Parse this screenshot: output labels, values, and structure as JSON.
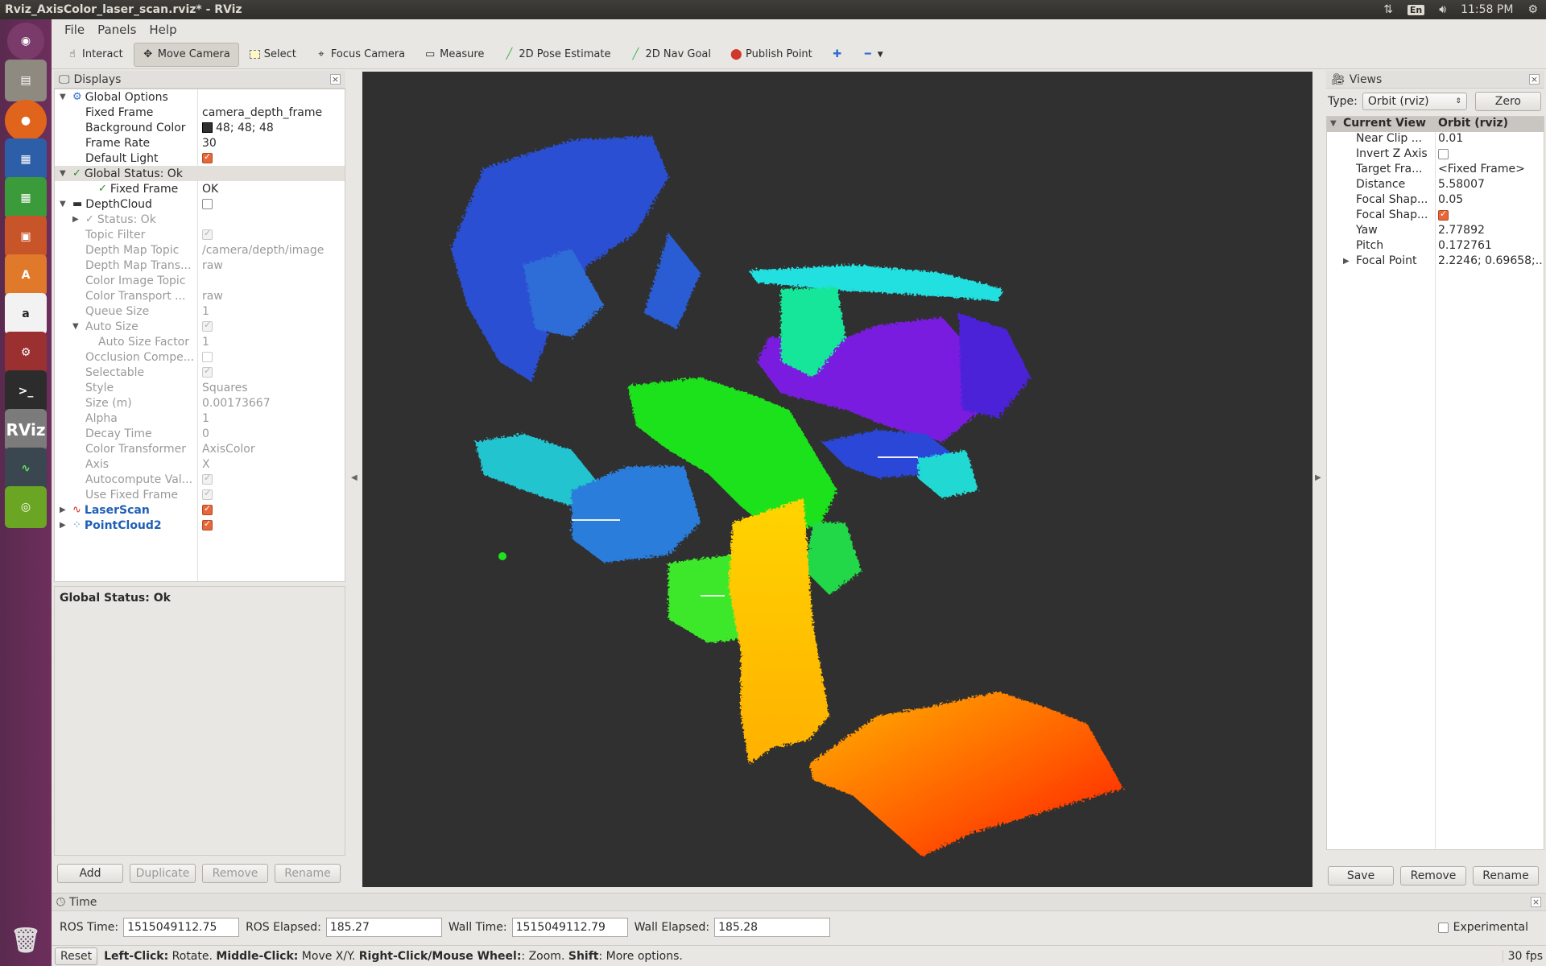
{
  "window_title": "Rviz_AxisColor_laser_scan.rviz* - RViz",
  "tray": {
    "lang": "En",
    "time": "11:58 PM"
  },
  "menu": [
    "File",
    "Panels",
    "Help"
  ],
  "tools": [
    {
      "label": "Interact",
      "icon": "interact-icon",
      "active": false
    },
    {
      "label": "Move Camera",
      "icon": "move-camera-icon",
      "active": true
    },
    {
      "label": "Select",
      "icon": "select-icon",
      "active": false
    },
    {
      "label": "Focus Camera",
      "icon": "focus-camera-icon",
      "active": false
    },
    {
      "label": "Measure",
      "icon": "measure-icon",
      "active": false
    },
    {
      "label": "2D Pose Estimate",
      "icon": "pose-estimate-icon",
      "active": false
    },
    {
      "label": "2D Nav Goal",
      "icon": "nav-goal-icon",
      "active": false
    },
    {
      "label": "Publish Point",
      "icon": "publish-point-icon",
      "active": false
    }
  ],
  "displays": {
    "title": "Displays",
    "rows": [
      {
        "indent": 0,
        "arrow": "▼",
        "icon": "gear",
        "label": "Global Options",
        "value": "",
        "style": "normal"
      },
      {
        "indent": 1,
        "label": "Fixed Frame",
        "value": "camera_depth_frame",
        "style": "normal"
      },
      {
        "indent": 1,
        "label": "Background Color",
        "value": "48; 48; 48",
        "swatch": true,
        "style": "normal"
      },
      {
        "indent": 1,
        "label": "Frame Rate",
        "value": "30",
        "style": "normal"
      },
      {
        "indent": 1,
        "label": "Default Light",
        "check": "on",
        "style": "normal"
      },
      {
        "indent": 0,
        "arrow": "▼",
        "icon": "check",
        "label": "Global Status: Ok",
        "value": "",
        "style": "normal",
        "selected": true
      },
      {
        "indent": 2,
        "icon": "check",
        "label": "Fixed Frame",
        "value": "OK",
        "style": "normal"
      },
      {
        "indent": 0,
        "arrow": "▼",
        "icon": "depth",
        "label": "DepthCloud",
        "check": "off",
        "style": "normal"
      },
      {
        "indent": 1,
        "arrow": "▶",
        "icon": "check",
        "label": "Status: Ok",
        "value": "",
        "style": "gray"
      },
      {
        "indent": 1,
        "label": "Topic Filter",
        "check": "dis",
        "style": "gray"
      },
      {
        "indent": 1,
        "label": "Depth Map Topic",
        "value": "/camera/depth/image",
        "style": "gray"
      },
      {
        "indent": 1,
        "label": "Depth Map Trans...",
        "value": "raw",
        "style": "gray"
      },
      {
        "indent": 1,
        "label": "Color Image Topic",
        "value": "",
        "style": "gray"
      },
      {
        "indent": 1,
        "label": "Color Transport ...",
        "value": "raw",
        "style": "gray"
      },
      {
        "indent": 1,
        "label": "Queue Size",
        "value": "1",
        "style": "gray"
      },
      {
        "indent": 1,
        "arrow": "▼",
        "label": "Auto Size",
        "check": "dis",
        "style": "gray"
      },
      {
        "indent": 2,
        "label": "Auto Size Factor",
        "value": "1",
        "style": "gray"
      },
      {
        "indent": 1,
        "label": "Occlusion Compe...",
        "check": "disoff",
        "style": "gray"
      },
      {
        "indent": 1,
        "label": "Selectable",
        "check": "dis",
        "style": "gray"
      },
      {
        "indent": 1,
        "label": "Style",
        "value": "Squares",
        "style": "gray"
      },
      {
        "indent": 1,
        "label": "Size (m)",
        "value": "0.00173667",
        "style": "gray"
      },
      {
        "indent": 1,
        "label": "Alpha",
        "value": "1",
        "style": "gray"
      },
      {
        "indent": 1,
        "label": "Decay Time",
        "value": "0",
        "style": "gray"
      },
      {
        "indent": 1,
        "label": "Color Transformer",
        "value": "AxisColor",
        "style": "gray"
      },
      {
        "indent": 1,
        "label": "Axis",
        "value": "X",
        "style": "gray"
      },
      {
        "indent": 1,
        "label": "Autocompute Val...",
        "check": "dis",
        "style": "gray"
      },
      {
        "indent": 1,
        "label": "Use Fixed Frame",
        "check": "dis",
        "style": "gray"
      },
      {
        "indent": 0,
        "arrow": "▶",
        "icon": "laser",
        "label": "LaserScan",
        "check": "on",
        "style": "blue"
      },
      {
        "indent": 0,
        "arrow": "▶",
        "icon": "cloud",
        "label": "PointCloud2",
        "check": "on",
        "style": "blue"
      }
    ],
    "description": "Global Status: Ok",
    "buttons": [
      {
        "label": "Add",
        "enabled": true
      },
      {
        "label": "Duplicate",
        "enabled": false
      },
      {
        "label": "Remove",
        "enabled": false
      },
      {
        "label": "Rename",
        "enabled": false
      }
    ]
  },
  "views": {
    "title": "Views",
    "type_label": "Type:",
    "type_value": "Orbit (rviz)",
    "zero_label": "Zero",
    "header": {
      "label": "Current View",
      "value": "Orbit (rviz)"
    },
    "rows": [
      {
        "label": "Near Clip ...",
        "value": "0.01"
      },
      {
        "label": "Invert Z Axis",
        "check": "off"
      },
      {
        "label": "Target Fra...",
        "value": "<Fixed Frame>"
      },
      {
        "label": "Distance",
        "value": "5.58007"
      },
      {
        "label": "Focal Shap...",
        "value": "0.05"
      },
      {
        "label": "Focal Shap...",
        "check": "on"
      },
      {
        "label": "Yaw",
        "value": "2.77892"
      },
      {
        "label": "Pitch",
        "value": "0.172761"
      },
      {
        "label": "Focal Point",
        "value": "2.2246; 0.69658;...",
        "arrow": "▶"
      }
    ],
    "buttons": [
      "Save",
      "Remove",
      "Rename"
    ]
  },
  "time": {
    "title": "Time",
    "ros_time_label": "ROS Time:",
    "ros_time": "1515049112.75",
    "ros_elapsed_label": "ROS Elapsed:",
    "ros_elapsed": "185.27",
    "wall_time_label": "Wall Time:",
    "wall_time": "1515049112.79",
    "wall_elapsed_label": "Wall Elapsed:",
    "wall_elapsed": "185.28",
    "experimental_label": "Experimental"
  },
  "status": {
    "reset": "Reset",
    "hint_parts": [
      [
        "Left-Click:",
        true
      ],
      [
        " Rotate. ",
        false
      ],
      [
        "Middle-Click:",
        true
      ],
      [
        " Move X/Y. ",
        false
      ],
      [
        "Right-Click/Mouse Wheel:",
        true
      ],
      [
        ": Zoom. ",
        false
      ],
      [
        "Shift",
        true
      ],
      [
        ": More options.",
        false
      ]
    ],
    "fps": "30 fps"
  },
  "viewport": {
    "background": "#303030"
  }
}
